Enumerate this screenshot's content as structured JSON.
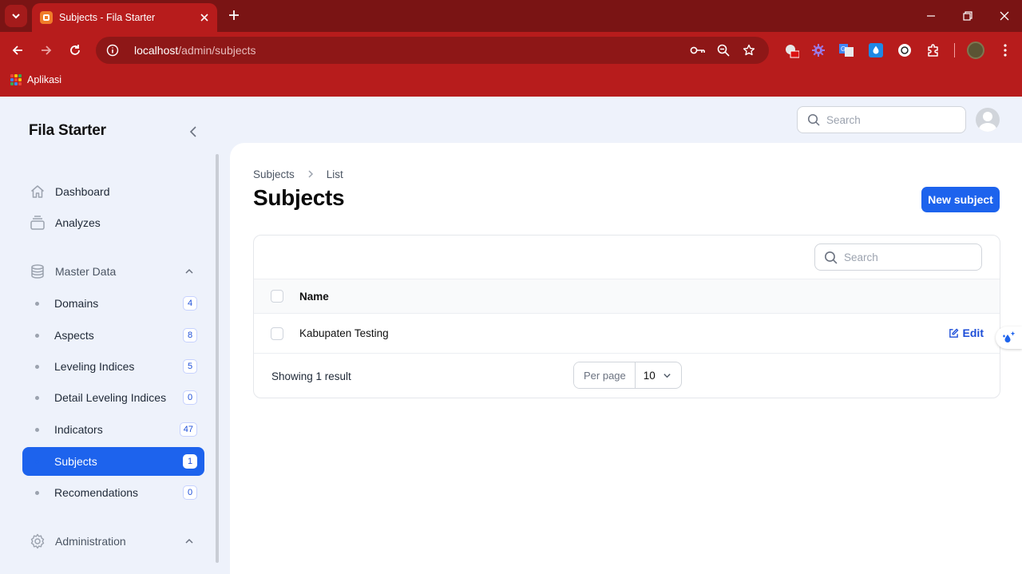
{
  "browser": {
    "tab_title": "Subjects - Fila Starter",
    "url_host": "localhost",
    "url_path": "/admin/subjects",
    "bookmark_apps_label": "Aplikasi"
  },
  "app": {
    "brand": "Fila Starter",
    "top_search_placeholder": "Search"
  },
  "sidebar": {
    "items": [
      {
        "label": "Dashboard",
        "icon": "home-icon"
      },
      {
        "label": "Analyzes",
        "icon": "stack-icon"
      }
    ],
    "master_group": {
      "label": "Master Data",
      "icon": "database-icon",
      "items": [
        {
          "label": "Domains",
          "count": "4"
        },
        {
          "label": "Aspects",
          "count": "8"
        },
        {
          "label": "Leveling Indices",
          "count": "5"
        },
        {
          "label": "Detail Leveling Indices",
          "count": "0"
        },
        {
          "label": "Indicators",
          "count": "47"
        },
        {
          "label": "Subjects",
          "count": "1",
          "active": true
        },
        {
          "label": "Recomendations",
          "count": "0"
        }
      ]
    },
    "admin_group": {
      "label": "Administration",
      "icon": "gear-icon"
    }
  },
  "main": {
    "breadcrumb": [
      "Subjects",
      "List"
    ],
    "title": "Subjects",
    "new_button": "New subject",
    "table": {
      "search_placeholder": "Search",
      "columns": [
        "Name"
      ],
      "rows": [
        {
          "name": "Kabupaten Testing",
          "action": "Edit"
        }
      ],
      "showing": "Showing 1 result",
      "per_page_label": "Per page",
      "per_page_value": "10"
    }
  },
  "colors": {
    "chrome": "#b71c1c",
    "accent": "#1d63ed"
  }
}
